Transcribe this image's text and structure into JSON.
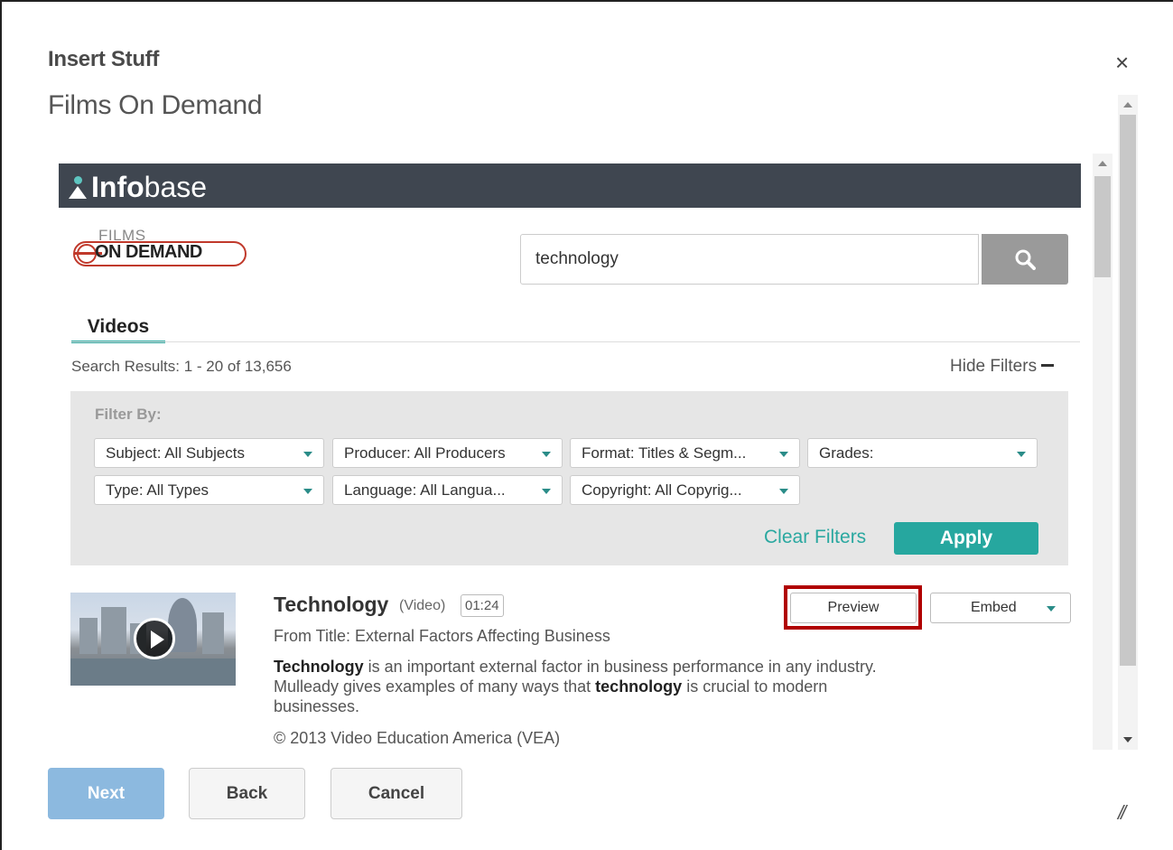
{
  "dialog": {
    "title": "Insert Stuff",
    "subtitle": "Films On Demand",
    "close_glyph": "×"
  },
  "header": {
    "brand_bold": "Info",
    "brand_rest": "base",
    "accent_color": "#2aa8a0"
  },
  "logo": {
    "films": "FILMS",
    "on_demand": "ON DEMAND"
  },
  "search": {
    "value": "technology",
    "icon": "search-icon"
  },
  "tabs": [
    {
      "label": "Videos",
      "active": true
    }
  ],
  "results": {
    "count_text": "Search Results: 1 - 20 of 13,656",
    "hide_filters": "Hide Filters"
  },
  "filters": {
    "heading": "Filter By:",
    "selects": [
      {
        "label": "Subject: All Subjects"
      },
      {
        "label": "Producer: All Producers"
      },
      {
        "label": "Format: Titles & Segm..."
      },
      {
        "label": "Grades:"
      },
      {
        "label": "Type: All Types"
      },
      {
        "label": "Language: All Langua..."
      },
      {
        "label": "Copyright: All Copyrig..."
      }
    ],
    "clear": "Clear Filters",
    "apply": "Apply"
  },
  "result_item": {
    "title": "Technology",
    "type": "(Video)",
    "duration": "01:24",
    "from_title": "From Title: External Factors Affecting Business",
    "desc_bold1": "Technology",
    "desc_part1": " is an important external factor in business performance in any industry. Mulleady gives examples of many ways that ",
    "desc_bold2": "technology",
    "desc_part2": " is crucial to modern businesses.",
    "copyright": "© 2013 Video Education America (VEA)",
    "preview": "Preview",
    "embed": "Embed"
  },
  "footer": {
    "next": "Next",
    "back": "Back",
    "cancel": "Cancel",
    "resize_glyph": "//"
  }
}
